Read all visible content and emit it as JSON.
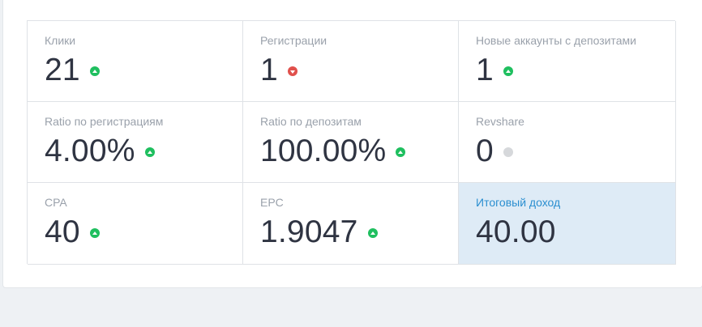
{
  "colors": {
    "up": "#1fbf5f",
    "down": "#e0504c",
    "neutral": "#d6d8db",
    "highlight_bg": "#deebf6",
    "highlight_label": "#2b8fd0"
  },
  "stats": [
    {
      "label": "Клики",
      "value": "21",
      "trend": "up"
    },
    {
      "label": "Регистрации",
      "value": "1",
      "trend": "down"
    },
    {
      "label": "Новые аккаунты с депозитами",
      "value": "1",
      "trend": "up"
    },
    {
      "label": "Ratio по регистрациям",
      "value": "4.00%",
      "trend": "up"
    },
    {
      "label": "Ratio по депозитам",
      "value": "100.00%",
      "trend": "up"
    },
    {
      "label": "Revshare",
      "value": "0",
      "trend": "neutral"
    },
    {
      "label": "CPA",
      "value": "40",
      "trend": "up"
    },
    {
      "label": "EPC",
      "value": "1.9047",
      "trend": "up"
    },
    {
      "label": "Итоговый доход",
      "value": "40.00",
      "trend": "none",
      "highlight": true
    }
  ]
}
